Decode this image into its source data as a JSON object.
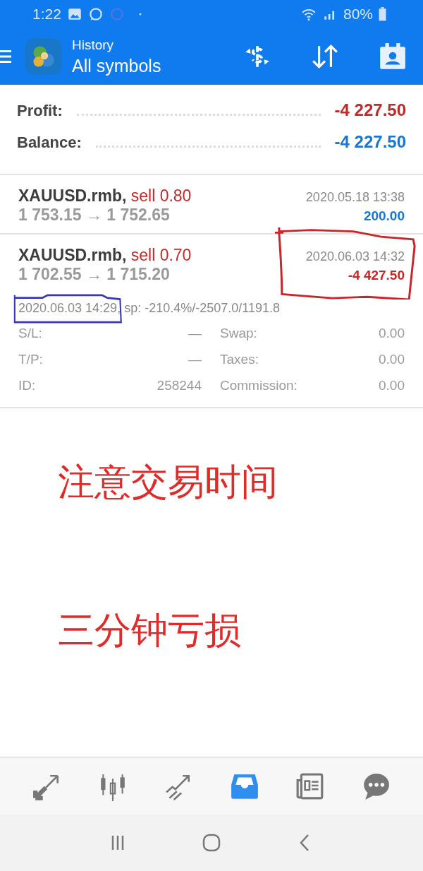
{
  "status_bar": {
    "time": "1:22",
    "battery": "80%"
  },
  "header": {
    "subtitle": "History",
    "title": "All symbols"
  },
  "summary": [
    {
      "label": "Profit:",
      "value": "-4 227.50",
      "kind": "profit"
    },
    {
      "label": "Balance:",
      "value": "-4 227.50",
      "kind": "balance"
    }
  ],
  "deals": [
    {
      "symbol": "XAUUSD.rmb,",
      "side": "sell 0.80",
      "prices": "1 753.15 → 1 752.65",
      "time": "2020.05.18 13:38",
      "profit": "200.00",
      "color": "#1976d2"
    },
    {
      "symbol": "XAUUSD.rmb,",
      "side": "sell 0.70",
      "prices": "1 702.55 → 1 715.20",
      "time": "2020.06.03 14:32",
      "profit": "-4 427.50",
      "color": "#c62828",
      "open_line": "2020.06.03 14:29, sp: -210.4%/-2507.0/1191.8",
      "details": [
        {
          "left_label": "S/L:",
          "left_value": "—",
          "right_label": "Swap:",
          "right_value": "0.00"
        },
        {
          "left_label": "T/P:",
          "left_value": "—",
          "right_label": "Taxes:",
          "right_value": "0.00"
        },
        {
          "left_label": "ID:",
          "left_value": "258244",
          "right_label": "Commission:",
          "right_value": "0.00"
        }
      ]
    }
  ],
  "annotations": [
    "注意交易时间",
    "三分钟亏损"
  ],
  "bottom_nav": [
    {
      "kind": "trade",
      "selected": false
    },
    {
      "kind": "chart",
      "selected": false
    },
    {
      "kind": "trend",
      "selected": false
    },
    {
      "kind": "history",
      "selected": true
    },
    {
      "kind": "news",
      "selected": false
    },
    {
      "kind": "chat",
      "selected": false
    }
  ]
}
